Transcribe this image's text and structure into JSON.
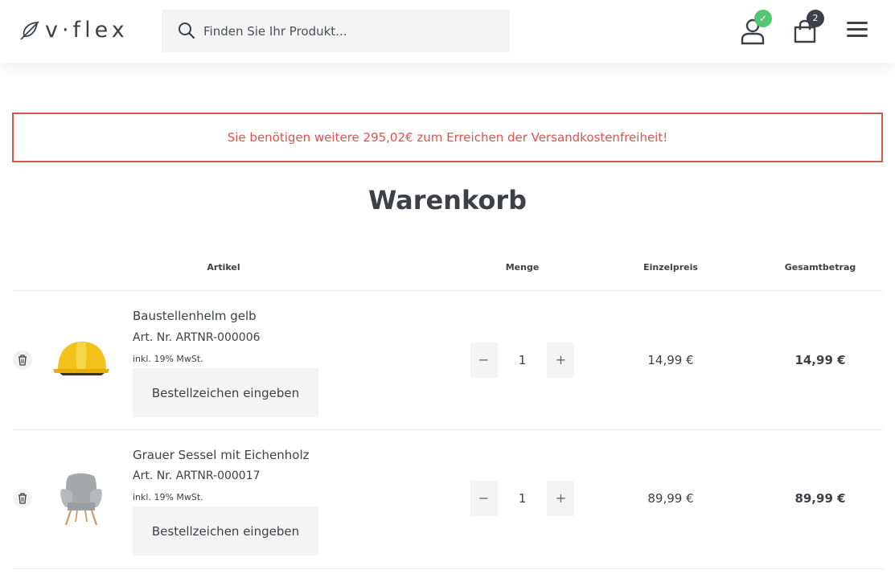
{
  "header": {
    "logo_text": "v·flex",
    "search_placeholder": "Finden Sie Ihr Produkt...",
    "account_badge": "✓",
    "cart_count": "2"
  },
  "notice": {
    "text": "Sie benötigen weitere 295,02€ zum Erreichen der Versandkostenfreiheit!",
    "color": "#d9544f"
  },
  "page": {
    "title": "Warenkorb"
  },
  "table": {
    "headers": {
      "article": "Artikel",
      "quantity": "Menge",
      "unit_price": "Einzelpreis",
      "total": "Gesamtbetrag"
    },
    "items": [
      {
        "name": "Baustellenhelm gelb",
        "article_number": "Art. Nr. ARTNR-000006",
        "tax_note": "inkl. 19% MwSt.",
        "reference_button": "Bestellzeichen eingeben",
        "quantity": "1",
        "unit_price": "14,99 €",
        "total": "14,99 €",
        "image_icon": "yellow-helmet-image"
      },
      {
        "name": "Grauer Sessel mit Eichenholz",
        "article_number": "Art. Nr. ARTNR-000017",
        "tax_note": "inkl. 19% MwSt.",
        "reference_button": "Bestellzeichen eingeben",
        "quantity": "1",
        "unit_price": "89,99 €",
        "total": "89,99 €",
        "image_icon": "grey-armchair-image"
      }
    ]
  },
  "controls": {
    "minus": "−",
    "plus": "+"
  },
  "colors": {
    "accent_green": "#55c670",
    "text": "#3d4147",
    "error": "#d9544f"
  }
}
